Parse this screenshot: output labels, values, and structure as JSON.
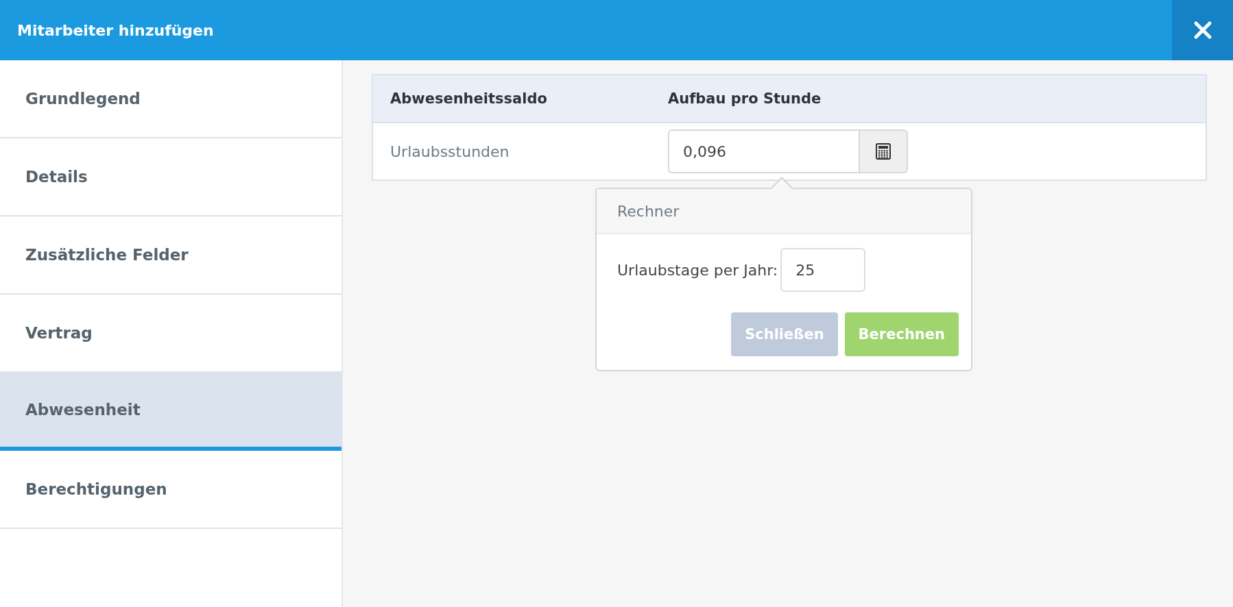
{
  "window": {
    "title": "Mitarbeiter hinzufügen"
  },
  "sidebar": {
    "items": [
      {
        "label": "Grundlegend",
        "selected": false
      },
      {
        "label": "Details",
        "selected": false
      },
      {
        "label": "Zusätzliche Felder",
        "selected": false
      },
      {
        "label": "Vertrag",
        "selected": false
      },
      {
        "label": "Abwesenheit",
        "selected": true
      },
      {
        "label": "Berechtigungen",
        "selected": false
      }
    ]
  },
  "table": {
    "columns": [
      "Abwesenheitssaldo",
      "Aufbau pro Stunde"
    ],
    "rows": [
      {
        "label": "Urlaubsstunden",
        "value": "0,096"
      }
    ]
  },
  "calculator": {
    "title": "Rechner",
    "field_label": "Urlaubstage per Jahr:",
    "field_value": "25",
    "buttons": [
      {
        "label": "Schließen",
        "kind": "secondary"
      },
      {
        "label": "Berechnen",
        "kind": "primary"
      }
    ]
  }
}
